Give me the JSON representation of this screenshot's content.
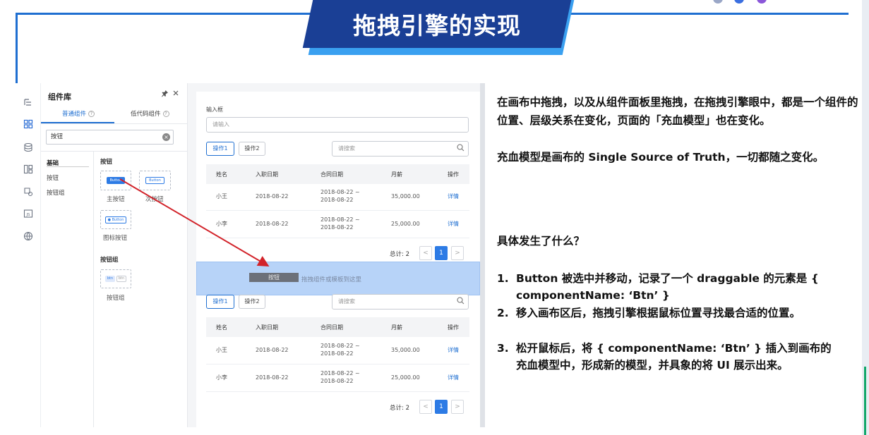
{
  "slide": {
    "title": "拖拽引擎的实现",
    "colors": {
      "banner": "#1a3f95",
      "banner_accent": "#3aa0f0",
      "frame": "#1f6fd1"
    }
  },
  "left_rail": {
    "icons": [
      "outline-tree-icon",
      "component-grid-icon",
      "database-icon",
      "layout-icon",
      "shape-icon",
      "js-icon",
      "globe-icon"
    ]
  },
  "component_panel": {
    "title": "组件库",
    "tabs": [
      {
        "label": "普通组件",
        "active": true
      },
      {
        "label": "低代码组件",
        "active": false
      }
    ],
    "search_value": "按钮",
    "categories": [
      {
        "label": "基础",
        "is_header": true
      },
      {
        "label": "按钮",
        "is_header": false
      },
      {
        "label": "按钮组",
        "is_header": false
      }
    ],
    "groups": [
      {
        "label": "按钮",
        "items": [
          {
            "label": "主按钮",
            "preview": "Button"
          },
          {
            "label": "次按钮",
            "preview": "Button"
          },
          {
            "label": "图标按钮",
            "preview": "Button"
          }
        ]
      },
      {
        "label": "按钮组",
        "items": [
          {
            "label": "按钮组",
            "preview": "btn"
          }
        ]
      }
    ]
  },
  "canvas": {
    "input_label": "输入框",
    "input_placeholder": "请输入",
    "blocks": [
      {
        "ops": [
          "操作1",
          "操作2"
        ],
        "search_placeholder": "请搜索",
        "columns": [
          "姓名",
          "入职日期",
          "合同日期",
          "月薪",
          "操作"
        ],
        "rows": [
          [
            "小王",
            "2018-08-22",
            "2018-08-22 ~ 2018-08-22",
            "35,000.00",
            "详情"
          ],
          [
            "小李",
            "2018-08-22",
            "2018-08-22 ~ 2018-08-22",
            "25,000.00",
            "详情"
          ]
        ],
        "total": "总计: 2",
        "page": "1"
      },
      {
        "ops": [
          "操作1",
          "操作2"
        ],
        "search_placeholder": "请搜索",
        "columns": [
          "姓名",
          "入职日期",
          "合同日期",
          "月薪",
          "操作"
        ],
        "rows": [
          [
            "小王",
            "2018-08-22",
            "2018-08-22 ~ 2018-08-22",
            "35,000.00",
            "详情"
          ],
          [
            "小李",
            "2018-08-22",
            "2018-08-22 ~ 2018-08-22",
            "25,000.00",
            "详情"
          ]
        ],
        "total": "总计: 2",
        "page": "1"
      }
    ],
    "drop_zone_text": "拖拽组件或模板到这里",
    "drag_ghost": "按钮",
    "prev_glyph": "<",
    "next_glyph": ">"
  },
  "notes": {
    "paragraph1": "在画布中拖拽，以及从组件面板里拖拽，在拖拽引擎眼中，都是一个组件的位置、层级关系在变化，页面的「充血模型」也在变化。",
    "paragraph2": "充血模型是画布的 Single Source of Truth，一切都随之变化。",
    "heading": "具体发生了什么？",
    "steps": [
      "Button 被选中并移动，记录了一个 draggable 的元素是 { componentName: ‘Btn’ }",
      "移入画布区后，拖拽引擎根据鼠标位置寻找最合适的位置。",
      "松开鼠标后，将 { componentName: ‘Btn’ } 插入到画布的充血模型中，形成新的模型，并具象的将 UI 展示出来。"
    ],
    "step_numbers": [
      "1.",
      "2.",
      "3."
    ]
  }
}
